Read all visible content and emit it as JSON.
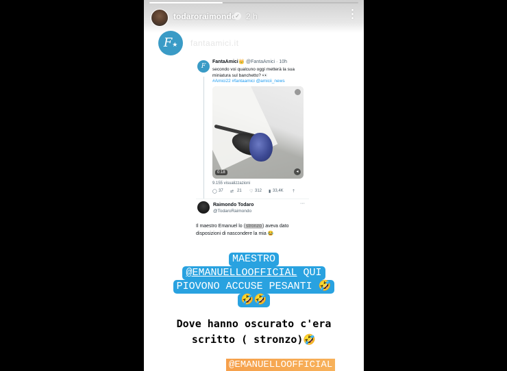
{
  "story": {
    "username": "todaroraimondo",
    "time": "2 h",
    "progress": 0.35,
    "verified_icon": "verified-check-icon"
  },
  "shared_account": {
    "handle": "fantaamici.it",
    "logo_text": "F"
  },
  "tweet": {
    "name": "FantaAmici",
    "badge": "👑",
    "handle_time": "@FantaAmici · 10h",
    "text": "secondo voi qualcuno oggi metterà la sua miniatura sul banchetto? 👀",
    "hashtags": "#Amici22 #fantaamici @amicii_news",
    "video_duration": "0:18",
    "views": "9.155 visualizzazioni",
    "replies": "37",
    "retweets": "21",
    "likes": "312",
    "impressions": "33,4K"
  },
  "reply": {
    "name": "Raimondo Todaro",
    "handle": "@TodaroRaimondo",
    "text_before": "Il maestro Emanuel lo (",
    "censored": "stronzo",
    "text_after": ") aveva dato disposizioni di nascondere la mia 😂"
  },
  "caption": {
    "line1": "MAESTRO",
    "line2_mention": "@EMANUELLOOFFICIAL",
    "line2_rest": " QUI",
    "line3": "PIOVONO ACCUSE PESANTI 🤣",
    "line4": "🤣🤣"
  },
  "overlay": {
    "line1": "Dove hanno oscurato c'era",
    "line2": "scritto ( stronzo)🤣"
  },
  "mention_sticker": "@EMANUELLOOFFICIAL"
}
